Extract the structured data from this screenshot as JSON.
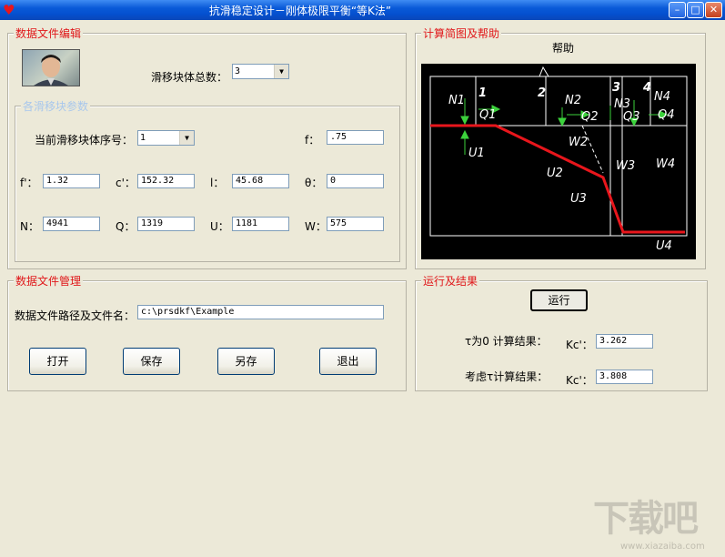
{
  "window": {
    "title": "抗滑稳定设计－刚体极限平衡“等K法”",
    "buttons": {
      "minimize": "–",
      "maximize": "□",
      "close": "✕"
    }
  },
  "data_edit": {
    "legend": "数据文件编辑",
    "total_blocks_label": "滑移块体总数：",
    "total_blocks_value": "3",
    "block_params": {
      "legend": "各滑移块参数",
      "current_block_label": "当前滑移块体序号：",
      "current_block_value": "1",
      "f_label": "f：",
      "f_value": ".75",
      "fprime_label": "f'：",
      "fprime_value": "1.32",
      "cprime_label": "c'：",
      "cprime_value": "152.32",
      "l_label": "l：",
      "l_value": "45.68",
      "theta_label": "θ：",
      "theta_value": "0",
      "N_label": "N：",
      "N_value": "4941",
      "Q_label": "Q：",
      "Q_value": "1319",
      "U_label": "U：",
      "U_value": "1181",
      "W_label": "W：",
      "W_value": "575"
    }
  },
  "diagram_panel": {
    "legend": "计算简图及帮助",
    "help_label": "帮助",
    "diagram_labels": [
      "N1",
      "1",
      "Q1",
      "U1",
      "2",
      "N2",
      "Q2",
      "W2",
      "U2",
      "3",
      "N3",
      "Q3",
      "W3",
      "U3",
      "4",
      "N4",
      "Q4",
      "W4",
      "U4"
    ]
  },
  "file_mgmt": {
    "legend": "数据文件管理",
    "path_label": "数据文件路径及文件名：",
    "path_value": "c:\\prsdkf\\Example",
    "open_label": "打开",
    "save_label": "保存",
    "saveas_label": "另存",
    "exit_label": "退出"
  },
  "results": {
    "legend": "运行及结果",
    "run_label": "运行",
    "tau0_label": "τ为0 计算结果：",
    "tau0_kc_label": "Kc'：",
    "tau0_kc_value": "3.262",
    "tau_label": "考虑τ计算结果：",
    "tau_kc_label": "Kc'：",
    "tau_kc_value": "3.808"
  },
  "watermark": {
    "text": "下载吧",
    "url": "www.xiazaiba.com"
  },
  "colors": {
    "legend_red": "#e0171a",
    "slip_line": "#e8161c",
    "titlebar_blue": "#0a5ad8"
  }
}
